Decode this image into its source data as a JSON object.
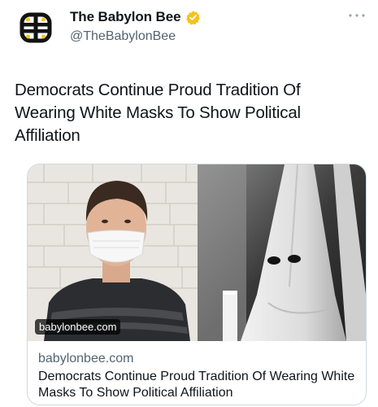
{
  "account": {
    "display_name": "The Babylon Bee",
    "handle": "@TheBabylonBee",
    "verified": true,
    "avatar_icon": "bee-logo-icon",
    "verified_icon": "verified-badge-icon",
    "verified_color": "#f4c21b"
  },
  "tweet": {
    "text": "Democrats Continue Proud Tradition Of Wearing White Masks To Show Political Affiliation"
  },
  "card": {
    "image_overlay_domain": "babylonbee.com",
    "domain": "babylonbee.com",
    "title": "Democrats Continue Proud Tradition Of Wearing White Masks To Show Political Affiliation"
  },
  "menu": {
    "more_icon": "more-options-icon"
  }
}
